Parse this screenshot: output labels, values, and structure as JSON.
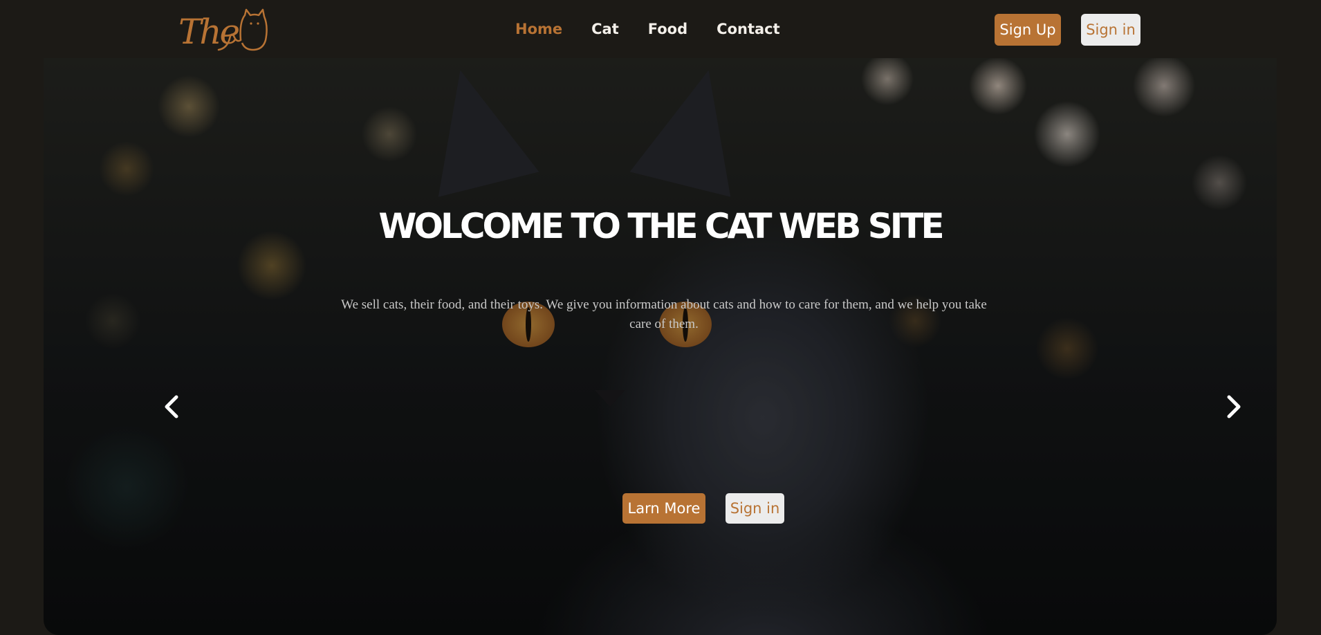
{
  "brand": {
    "logo_text": "The",
    "accent_color": "#b87334"
  },
  "nav": {
    "links": [
      {
        "label": "Home",
        "active": true
      },
      {
        "label": "Cat",
        "active": false
      },
      {
        "label": "Food",
        "active": false
      },
      {
        "label": "Contact",
        "active": false
      }
    ],
    "signup_label": "Sign Up",
    "signin_label": "Sign in"
  },
  "hero": {
    "title": "WOLCOME TO THE CAT WEB SITE",
    "text": "We sell cats, their food, and their toys. We give you information about cats and how to care for them, and we help you take care of them.",
    "learn_more_label": "Larn More",
    "signin_label": "Sign in",
    "prev_icon": "chevron-left-icon",
    "next_icon": "chevron-right-icon"
  }
}
